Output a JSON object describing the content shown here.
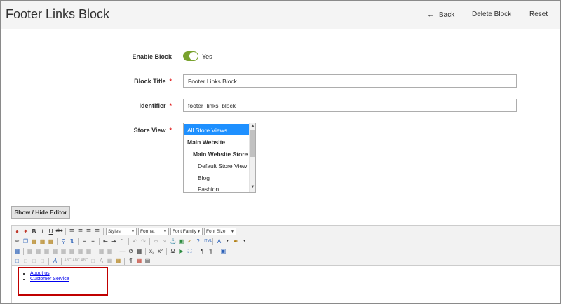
{
  "header": {
    "title": "Footer Links Block",
    "back_label": "Back",
    "delete_label": "Delete Block",
    "reset_label": "Reset"
  },
  "form": {
    "enable_block": {
      "label": "Enable Block",
      "value_text": "Yes",
      "enabled": true
    },
    "block_title": {
      "label": "Block Title",
      "value": "Footer Links Block",
      "required_mark": "*"
    },
    "identifier": {
      "label": "Identifier",
      "value": "footer_links_block",
      "required_mark": "*"
    },
    "store_view": {
      "label": "Store View",
      "required_mark": "*",
      "options": [
        {
          "label": "All Store Views",
          "selected": true,
          "bold": false,
          "indent": 0
        },
        {
          "label": "Main Website",
          "selected": false,
          "bold": true,
          "indent": 0
        },
        {
          "label": "Main Website Store",
          "selected": false,
          "bold": true,
          "indent": 1
        },
        {
          "label": "Default Store View",
          "selected": false,
          "bold": false,
          "indent": 2
        },
        {
          "label": "Blog",
          "selected": false,
          "bold": false,
          "indent": 2
        },
        {
          "label": "Fashion",
          "selected": false,
          "bold": false,
          "indent": 2
        }
      ]
    }
  },
  "editor": {
    "toggle_label": "Show / Hide Editor",
    "toolbar": {
      "styles_label": "Styles",
      "format_label": "Format",
      "font_family_label": "Font Family",
      "font_size_label": "Font Size"
    },
    "content_items": [
      "About us",
      "Customer Service"
    ]
  },
  "colors": {
    "toggle_on": "#79a22e",
    "selected_option": "#1e90ff",
    "required": "#e22626",
    "highlight_border": "#c00000",
    "link": "#0000ee"
  }
}
